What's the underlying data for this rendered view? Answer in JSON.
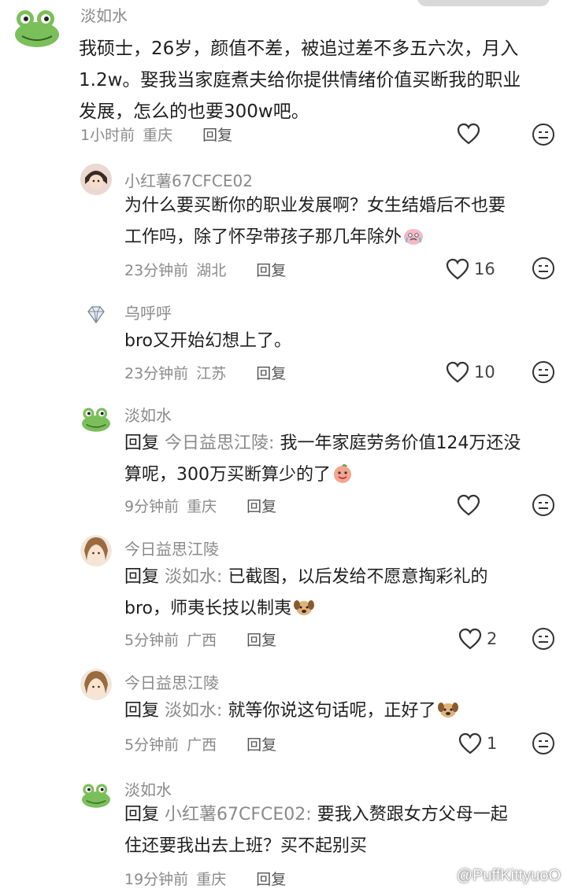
{
  "comments": [
    {
      "name": "淡如水",
      "lines": [
        "我硕士，26岁，颜值不差，被追过差不多五六次，月入",
        "1.2w。娶我当家庭煮夫给你提供情绪价值买断我的职业",
        "发展，怎么的也要300w吧。"
      ],
      "time": "1小时前",
      "location": "重庆",
      "reply_label": "回复",
      "likes": ""
    },
    {
      "name": "小红薯67CFCE02",
      "lines": [
        "为什么要买断你的职业发展啊？女生结婚后不也要",
        "工作吗，除了怀孕带孩子那几年除外"
      ],
      "time": "23分钟前",
      "location": "湖北",
      "reply_label": "回复",
      "likes": "16"
    },
    {
      "name": "乌呼呼",
      "lines": [
        "bro又开始幻想上了。"
      ],
      "time": "23分钟前",
      "location": "江苏",
      "reply_label": "回复",
      "likes": "10"
    },
    {
      "name": "淡如水",
      "reply_prefix": "回复",
      "reply_to": "今日益思江陵:",
      "lines": [
        "我一年家庭劳务价值124万还没",
        "算呢，300万买断算少的了"
      ],
      "time": "9分钟前",
      "location": "重庆",
      "reply_label": "回复",
      "likes": ""
    },
    {
      "name": "今日益思江陵",
      "reply_prefix": "回复",
      "reply_to": "淡如水:",
      "lines": [
        "已截图，以后发给不愿意掏彩礼的",
        "bro，师夷长技以制夷"
      ],
      "time": "5分钟前",
      "location": "广西",
      "reply_label": "回复",
      "likes": "2"
    },
    {
      "name": "今日益思江陵",
      "reply_prefix": "回复",
      "reply_to": "淡如水:",
      "lines": [
        "就等你说这句话呢，正好了"
      ],
      "time": "5分钟前",
      "location": "广西",
      "reply_label": "回复",
      "likes": "1"
    },
    {
      "name": "淡如水",
      "reply_prefix": "回复",
      "reply_to": "小红薯67CFCE02:",
      "lines": [
        "要我入赘跟女方父母一起",
        "住还要我出去上班？买不起别买"
      ],
      "time": "19分钟前",
      "location": "重庆",
      "reply_label": "回复",
      "likes": ""
    }
  ],
  "watermark": "@PuffKittyuoO",
  "icons": {
    "like": "heart-outline-icon",
    "dislike": "meh-face-icon",
    "watermark": "weibo-logo-icon"
  },
  "colors": {
    "name_gray": "#8a8a8a",
    "text": "#1f1f1f",
    "icon_stroke": "#333333",
    "frog_green": "#7bbf5a"
  }
}
